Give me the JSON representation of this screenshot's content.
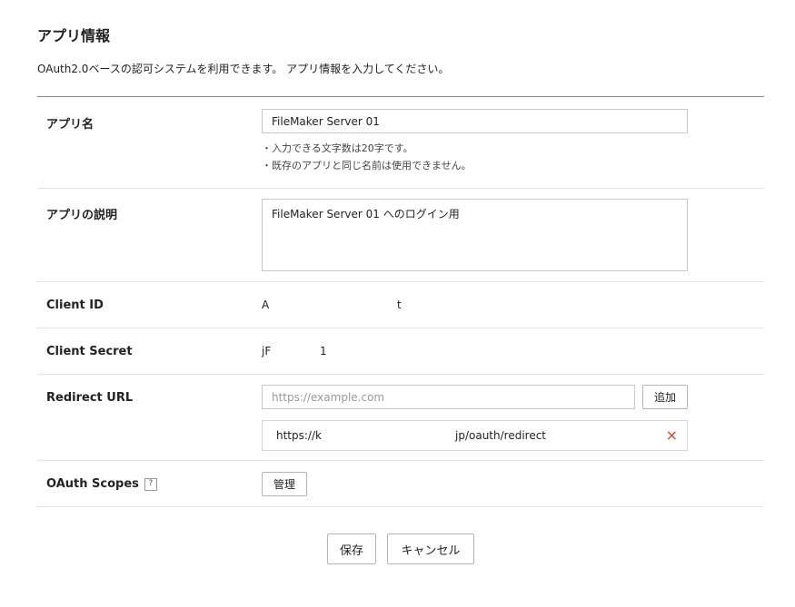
{
  "header": {
    "title": "アプリ情報",
    "description": "OAuth2.0ベースの認可システムを利用できます。 アプリ情報を入力してください。"
  },
  "form": {
    "app_name": {
      "label": "アプリ名",
      "value": "FileMaker Server 01",
      "hints": [
        "・入力できる文字数は20字です。",
        "・既存のアプリと同じ名前は使用できません。"
      ]
    },
    "app_desc": {
      "label": "アプリの説明",
      "value": "FileMaker Server 01 へのログイン用"
    },
    "client_id": {
      "label": "Client ID",
      "value_start": "A",
      "value_end": "t"
    },
    "client_secret": {
      "label": "Client Secret",
      "value_start": "jF",
      "value_end": "1"
    },
    "redirect_url": {
      "label": "Redirect URL",
      "placeholder": "https://example.com",
      "add_label": "追加",
      "url_start": "https://k",
      "url_end": "jp/oauth/redirect",
      "remove_icon": "×"
    },
    "oauth_scopes": {
      "label": "OAuth Scopes",
      "help_icon": "?",
      "manage_label": "管理"
    }
  },
  "actions": {
    "save_label": "保存",
    "cancel_label": "キャンセル"
  },
  "colors": {
    "remove_icon": "#e53935",
    "divider_strong": "#8a8a8a",
    "divider": "#e4e4e4"
  }
}
